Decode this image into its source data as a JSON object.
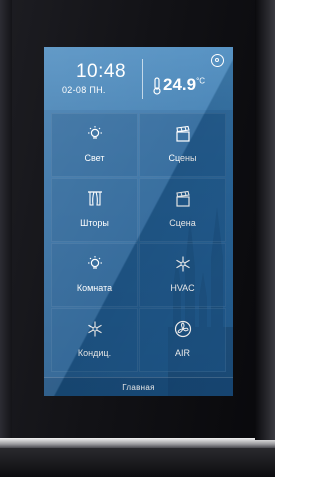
{
  "header": {
    "time": "10:48",
    "date": "02-08 ПН.",
    "temperature": "24.9",
    "temperature_unit": "°C"
  },
  "tiles": [
    {
      "label": "Свет",
      "icon": "light-bulb-icon"
    },
    {
      "label": "Сцены",
      "icon": "clapperboard-icon"
    },
    {
      "label": "Шторы",
      "icon": "curtain-icon"
    },
    {
      "label": "Сцена",
      "icon": "clapperboard-icon"
    },
    {
      "label": "Комната",
      "icon": "light-bulb-icon"
    },
    {
      "label": "HVAC",
      "icon": "snowflake-icon"
    },
    {
      "label": "Кондиц.",
      "icon": "snowflake-icon"
    },
    {
      "label": "AIR",
      "icon": "fan-icon"
    }
  ],
  "footer": {
    "label": "Главная"
  },
  "colors": {
    "screen_blue": "#2b6aa1",
    "header_blue": "#4587bd",
    "frame_black": "#121216",
    "text": "#ffffff"
  }
}
